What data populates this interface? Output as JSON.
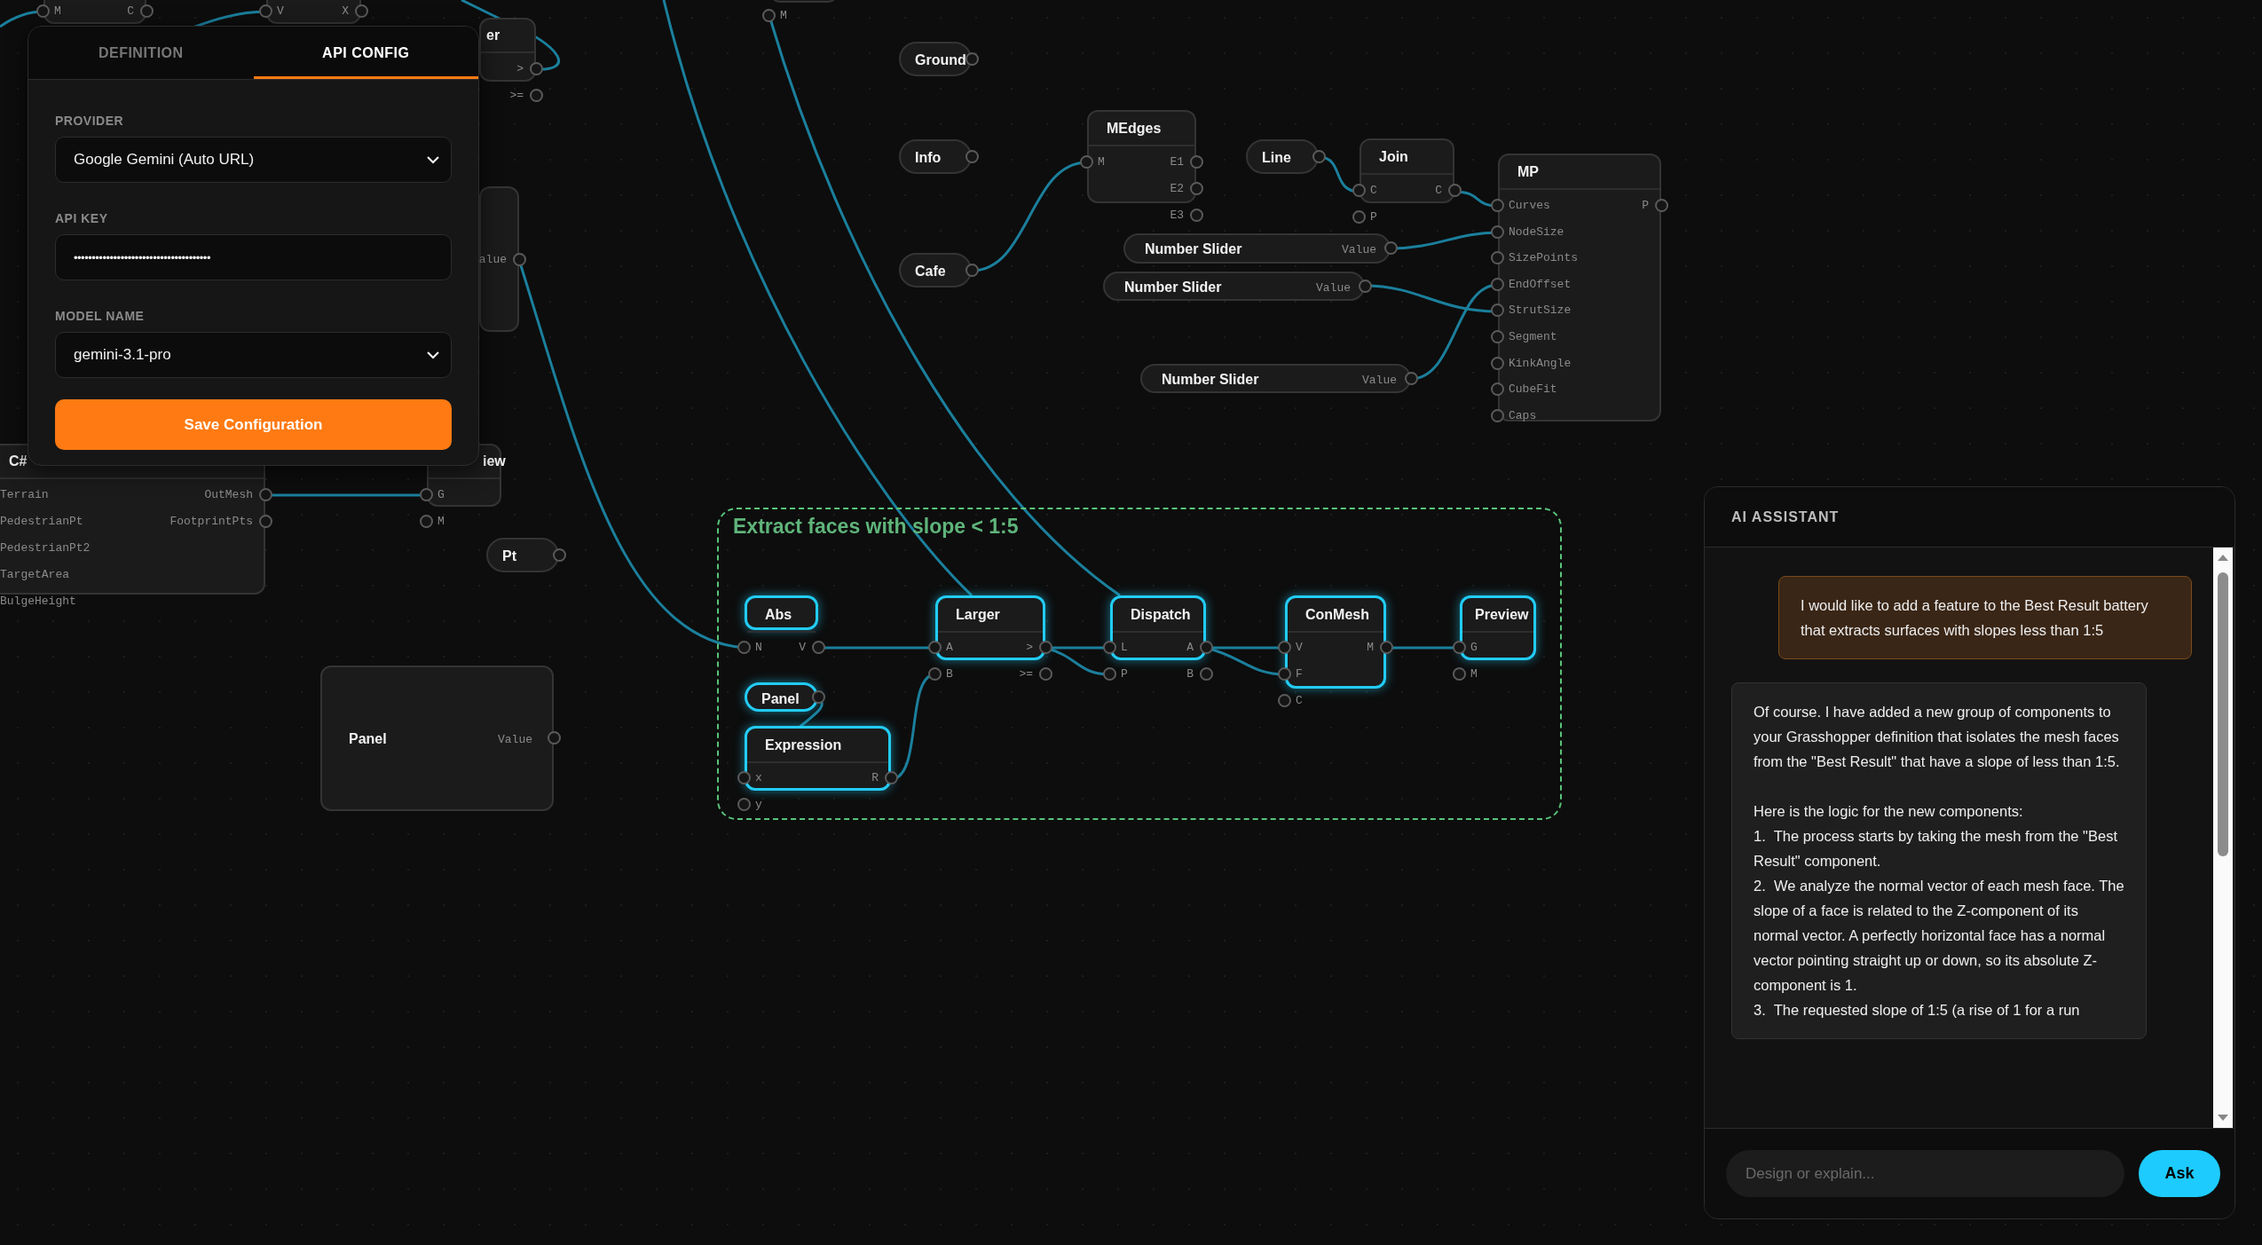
{
  "config_panel": {
    "tabs": [
      {
        "label": "DEFINITION",
        "selected": false
      },
      {
        "label": "API CONFIG",
        "selected": true
      }
    ],
    "fields": [
      {
        "kind": "select",
        "label": "PROVIDER",
        "value": "Google Gemini (Auto URL)"
      },
      {
        "kind": "password",
        "label": "API KEY",
        "value": "••••••••••••••••••••••••••••••••••••••"
      },
      {
        "kind": "select",
        "label": "MODEL NAME",
        "value": "gemini-3.1-pro"
      }
    ],
    "save_button": "Save Configuration"
  },
  "canvas": {
    "group": {
      "title": "Extract faces with slope < 1:5"
    },
    "nodes": [
      {
        "kind": "component",
        "selected": false,
        "inputs": [
          "M"
        ],
        "outputs": [
          "C"
        ]
      },
      {
        "kind": "component",
        "selected": false,
        "inputs": [
          "V"
        ],
        "outputs": [
          "X"
        ]
      },
      {
        "kind": "component",
        "selected": false,
        "inputs": [
          "M"
        ]
      },
      {
        "kind": "component",
        "title": "er",
        "selected": false,
        "outputs": [
          ">",
          ">="
        ]
      },
      {
        "kind": "component",
        "selected": false,
        "outputs": [
          "alue"
        ]
      },
      {
        "kind": "component",
        "title": "C#",
        "selected": false,
        "inputs": [
          "Terrain",
          "PedestrianPt",
          "PedestrianPt2",
          "TargetArea",
          "BulgeHeight"
        ],
        "outputs": [
          "OutMesh",
          "FootprintPts"
        ]
      },
      {
        "kind": "component",
        "title": "iew",
        "selected": false,
        "inputs": [
          "G",
          "M"
        ]
      },
      {
        "kind": "pill",
        "title": "Pt",
        "selected": false
      },
      {
        "kind": "panel",
        "title": "Panel",
        "selected": false,
        "output": "Value"
      },
      {
        "kind": "pill",
        "title": "Ground",
        "selected": false
      },
      {
        "kind": "pill",
        "title": "Info",
        "selected": false
      },
      {
        "kind": "pill",
        "title": "Cafe",
        "selected": false
      },
      {
        "kind": "component",
        "title": "MEdges",
        "selected": false,
        "inputs": [
          "M"
        ],
        "outputs": [
          "E1",
          "E2",
          "E3"
        ]
      },
      {
        "kind": "pill",
        "title": "Line",
        "selected": false
      },
      {
        "kind": "component",
        "title": "Join",
        "selected": false,
        "inputs": [
          "C",
          "P"
        ],
        "outputs": [
          "C"
        ]
      },
      {
        "kind": "component",
        "title": "MP",
        "selected": false,
        "inputs": [
          "Curves",
          "NodeSize",
          "SizePoints",
          "EndOffset",
          "StrutSize",
          "Segment",
          "KinkAngle",
          "CubeFit",
          "Caps"
        ],
        "outputs": [
          "P"
        ]
      },
      {
        "kind": "slider",
        "title": "Number Slider",
        "selected": false,
        "output": "Value"
      },
      {
        "kind": "slider",
        "title": "Number Slider",
        "selected": false,
        "output": "Value"
      },
      {
        "kind": "slider",
        "title": "Number Slider",
        "selected": false,
        "output": "Value"
      },
      {
        "kind": "component",
        "title": "Abs",
        "selected": true,
        "inputs": [
          "N"
        ],
        "outputs": [
          "V"
        ]
      },
      {
        "kind": "component",
        "title": "Larger",
        "selected": true,
        "inputs": [
          "A",
          "B"
        ],
        "outputs": [
          ">",
          ">="
        ]
      },
      {
        "kind": "component",
        "title": "Dispatch",
        "selected": true,
        "inputs": [
          "L",
          "P"
        ],
        "outputs": [
          "A",
          "B"
        ]
      },
      {
        "kind": "component",
        "title": "ConMesh",
        "selected": true,
        "inputs": [
          "V",
          "F",
          "C"
        ],
        "outputs": [
          "M"
        ]
      },
      {
        "kind": "component",
        "title": "Preview",
        "selected": true,
        "inputs": [
          "G",
          "M"
        ]
      },
      {
        "kind": "pill",
        "title": "Panel",
        "selected": true
      },
      {
        "kind": "component",
        "title": "Expression",
        "selected": true,
        "inputs": [
          "x",
          "y"
        ],
        "outputs": [
          "R"
        ]
      }
    ]
  },
  "assistant": {
    "title": "AI ASSISTANT",
    "messages": [
      {
        "kind": "user",
        "paragraphs": [
          [
            "I would like to add a feature to the Best Result battery that extracts surfaces with slopes less than 1:5"
          ]
        ]
      },
      {
        "kind": "assistant",
        "paragraphs": [
          [
            "Of course. I have added a new group of components to your Grasshopper definition that isolates the mesh faces from the \"Best Result\" that have a slope of less than 1:5."
          ],
          [
            "Here is the logic for the new components:",
            "1.  The process starts by taking the mesh from the \"Best Result\" component.",
            "2.  We analyze the normal vector of each mesh face. The slope of a face is related to the Z-component of its normal vector. A perfectly horizontal face has a normal vector pointing straight up or down, so its absolute Z-component is 1.",
            "3.  The requested slope of 1:5 (a rise of 1 for a run"
          ]
        ]
      }
    ],
    "input": {
      "placeholder": "Design or explain..."
    },
    "ask_button": "Ask"
  }
}
